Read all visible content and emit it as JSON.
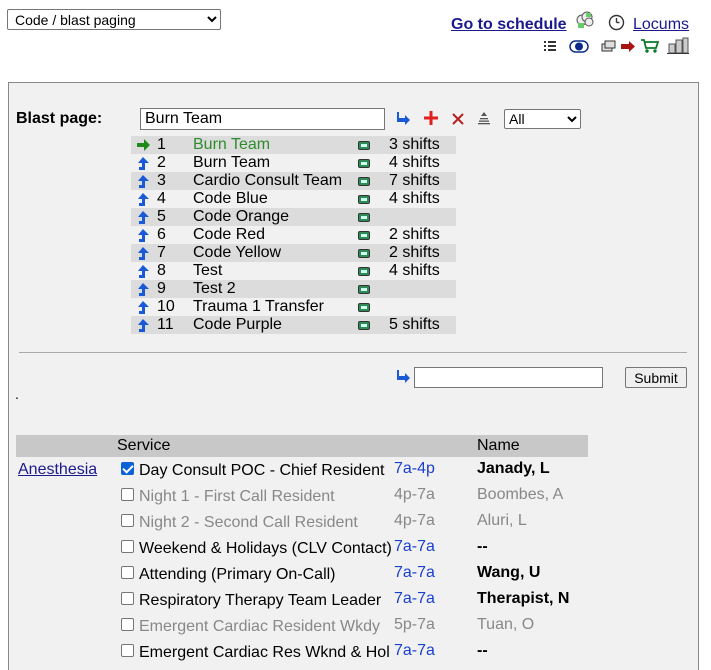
{
  "top": {
    "mode_select": "Code / blast paging",
    "go_to_schedule": "Go to schedule",
    "locums": "Locums"
  },
  "blast": {
    "label": "Blast page:",
    "input_value": "Burn Team",
    "filter_select": "All",
    "rows": [
      {
        "num": "1",
        "name": "Burn Team",
        "shifts": "3 shifts",
        "current": true
      },
      {
        "num": "2",
        "name": "Burn Team",
        "shifts": "4 shifts"
      },
      {
        "num": "3",
        "name": "Cardio Consult Team",
        "shifts": "7 shifts"
      },
      {
        "num": "4",
        "name": "Code Blue",
        "shifts": "4 shifts"
      },
      {
        "num": "5",
        "name": "Code Orange",
        "shifts": ""
      },
      {
        "num": "6",
        "name": "Code Red",
        "shifts": "2 shifts"
      },
      {
        "num": "7",
        "name": "Code Yellow",
        "shifts": "2 shifts"
      },
      {
        "num": "8",
        "name": "Test",
        "shifts": "4 shifts"
      },
      {
        "num": "9",
        "name": "Test 2",
        "shifts": ""
      },
      {
        "num": "10",
        "name": "Trauma 1 Transfer",
        "shifts": ""
      },
      {
        "num": "11",
        "name": "Code Purple",
        "shifts": "5 shifts"
      }
    ],
    "submit_label": "Submit",
    "dot": "."
  },
  "table": {
    "col_service": "Service",
    "col_name": "Name",
    "department": "Anesthesia",
    "rows": [
      {
        "service": "Day Consult POC - Chief Resident",
        "time": "7a-4p",
        "name": "Janady, L",
        "checked": true,
        "active": true
      },
      {
        "service": "Night 1 - First Call Resident",
        "time": "4p-7a",
        "name": "Boombes, A",
        "checked": false,
        "active": false
      },
      {
        "service": "Night 2 - Second Call Resident",
        "time": "4p-7a",
        "name": "Aluri, L",
        "checked": false,
        "active": false
      },
      {
        "service": "Weekend & Holidays (CLV Contact)",
        "time": "7a-7a",
        "name": "--",
        "checked": false,
        "active": true
      },
      {
        "service": "Attending (Primary On-Call)",
        "time": "7a-7a",
        "name": "Wang, U",
        "checked": false,
        "active": true
      },
      {
        "service": "Respiratory Therapy Team Leader",
        "time": "7a-7a",
        "name": "Therapist, N",
        "checked": false,
        "active": true
      },
      {
        "service": "Emergent Cardiac Resident Wkdy",
        "time": "5p-7a",
        "name": "Tuan, O",
        "checked": false,
        "active": false
      },
      {
        "service": "Emergent Cardiac Res Wknd & Hol",
        "time": "7a-7a",
        "name": "--",
        "checked": false,
        "active": true
      }
    ]
  }
}
